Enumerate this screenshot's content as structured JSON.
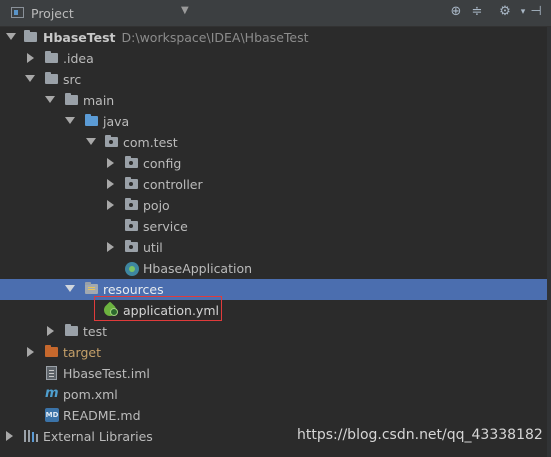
{
  "header": {
    "title": "Project",
    "icons": [
      "project-view-icon",
      "chevron-down-icon",
      "target-icon",
      "collapse-icon",
      "gear-icon",
      "hide-icon"
    ]
  },
  "tree": {
    "root_name": "HbaseTest",
    "root_path": "D:\\workspace\\IDEA\\HbaseTest",
    "idea": ".idea",
    "src": "src",
    "main": "main",
    "java": "java",
    "package": "com.test",
    "config": "config",
    "controller": "controller",
    "pojo": "pojo",
    "service": "service",
    "util": "util",
    "app_class": "HbaseApplication",
    "resources": "resources",
    "yml": "application.yml",
    "test": "test",
    "target": "target",
    "iml": "HbaseTest.iml",
    "pom": "pom.xml",
    "readme": "README.md",
    "libraries": "External Libraries",
    "selected": "resources",
    "highlighted": "application.yml"
  },
  "icons": {
    "m_glyph": "m",
    "md_glyph": "MD"
  },
  "watermark": "https://blog.csdn.net/qq_43338182"
}
